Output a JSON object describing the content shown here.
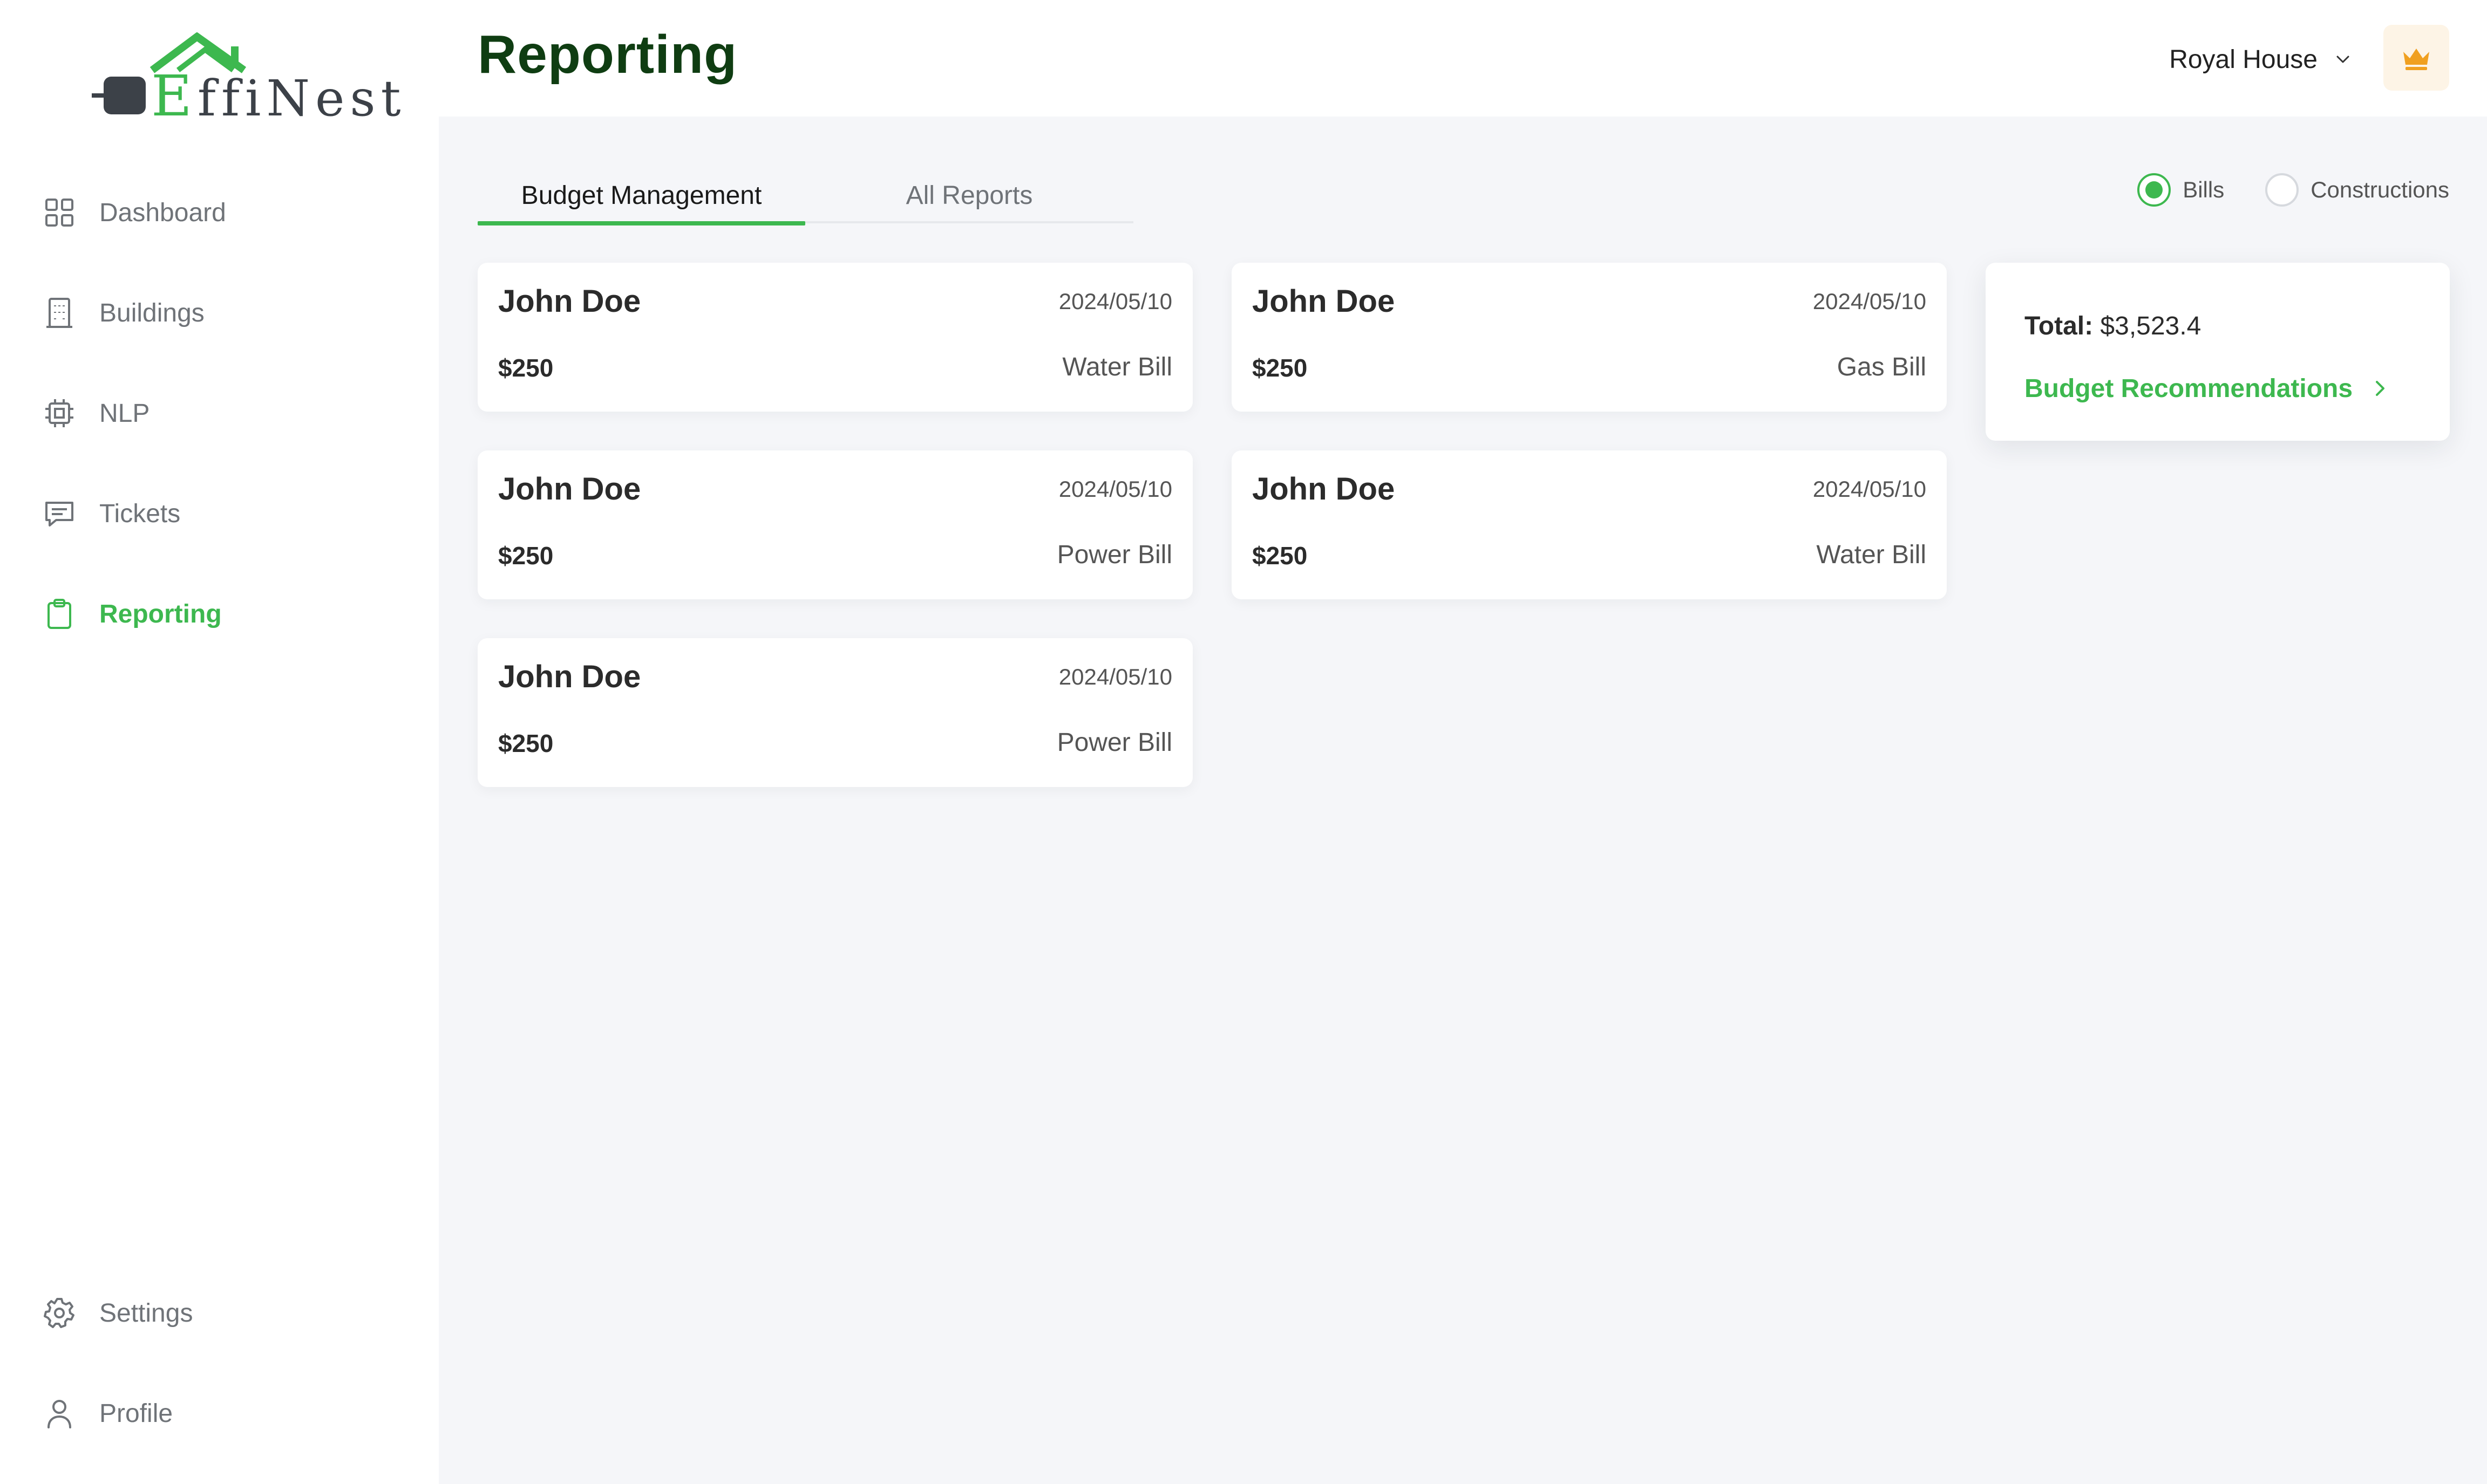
{
  "app": {
    "logo_text_e": "E",
    "logo_text_rest": "ffiNest"
  },
  "sidebar": {
    "items": [
      {
        "label": "Dashboard",
        "icon": "grid-icon"
      },
      {
        "label": "Buildings",
        "icon": "building-icon"
      },
      {
        "label": "NLP",
        "icon": "chip-icon"
      },
      {
        "label": "Tickets",
        "icon": "message-icon"
      },
      {
        "label": "Reporting",
        "icon": "clipboard-icon",
        "active": true
      }
    ],
    "bottom_items": [
      {
        "label": "Settings",
        "icon": "gear-icon"
      },
      {
        "label": "Profile",
        "icon": "user-icon"
      }
    ]
  },
  "header": {
    "title": "Reporting",
    "house_select": "Royal House",
    "crown_icon": "crown-icon"
  },
  "tabs": [
    {
      "label": "Budget Management",
      "active": true
    },
    {
      "label": "All Reports",
      "active": false
    }
  ],
  "filters": {
    "options": [
      {
        "label": "Bills",
        "checked": true
      },
      {
        "label": "Constructions",
        "checked": false
      }
    ]
  },
  "cards": [
    {
      "name": "John Doe",
      "date": "2024/05/10",
      "amount": "$250",
      "type": "Water Bill"
    },
    {
      "name": "John Doe",
      "date": "2024/05/10",
      "amount": "$250",
      "type": "Gas Bill"
    },
    {
      "name": "John Doe",
      "date": "2024/05/10",
      "amount": "$250",
      "type": "Power Bill"
    },
    {
      "name": "John Doe",
      "date": "2024/05/10",
      "amount": "$250",
      "type": "Water Bill"
    },
    {
      "name": "John Doe",
      "date": "2024/05/10",
      "amount": "$250",
      "type": "Power Bill"
    }
  ],
  "summary": {
    "total_label": "Total:",
    "total_value": "$3,523.4",
    "recommendations_label": "Budget Recommendations"
  },
  "colors": {
    "accent": "#3db84f",
    "title": "#0f3d12",
    "crown": "#f0a020",
    "background": "#f5f6f9"
  }
}
